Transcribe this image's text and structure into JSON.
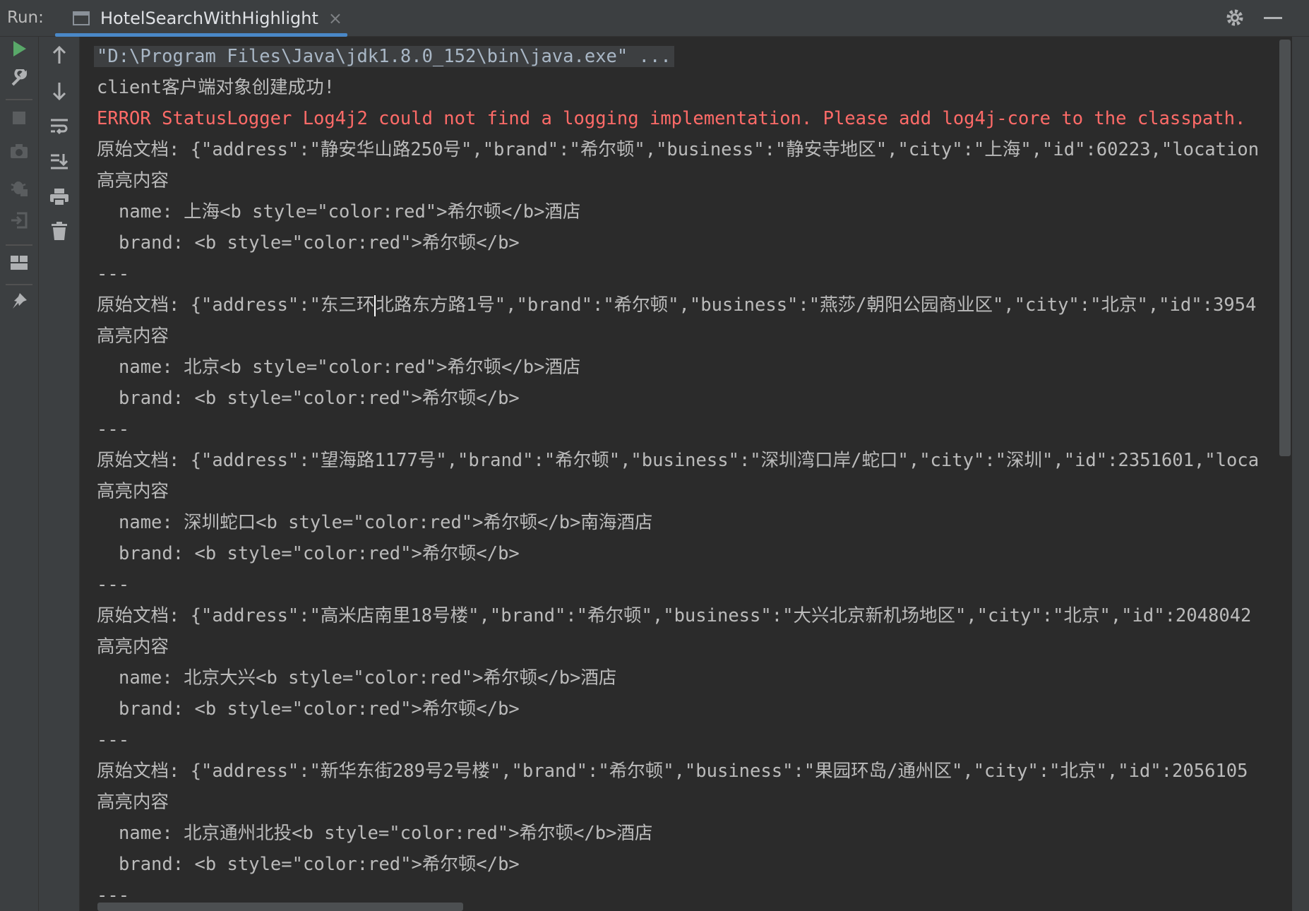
{
  "run_panel": {
    "label": "Run:",
    "tab_title": "HotelSearchWithHighlight",
    "tab_close": "×"
  },
  "colors": {
    "run_green": "#59a869",
    "error_red": "#ff6b68",
    "tab_underline": "#4a88c7",
    "console_bg": "#2b2b2b"
  },
  "toolbar_left": [
    "run-icon",
    "wrench-icon",
    "stop-icon",
    "camera-icon",
    "debug-bug-icon",
    "login-icon",
    "layout-icon",
    "pin-icon"
  ],
  "toolbar_right": [
    "up-arrow-icon",
    "down-arrow-icon",
    "soft-wrap-icon",
    "scroll-to-end-icon",
    "print-icon",
    "trash-icon"
  ],
  "console": {
    "cmd": "\"D:\\Program Files\\Java\\jdk1.8.0_152\\bin\\java.exe\" ...",
    "client_ok": "client客户端对象创建成功!",
    "error": "ERROR StatusLogger Log4j2 could not find a logging implementation. Please add log4j-core to the classpath.",
    "sep": "---",
    "highlight_label": "高亮内容",
    "records": [
      {
        "original": "原始文档: {\"address\":\"静安华山路250号\",\"brand\":\"希尔顿\",\"business\":\"静安寺地区\",\"city\":\"上海\",\"id\":60223,\"location",
        "name": "name: 上海<b style=\"color:red\">希尔顿</b>酒店",
        "brand": "brand: <b style=\"color:red\">希尔顿</b>"
      },
      {
        "original_a": "原始文档: {\"address\":\"东三环",
        "original_b": "北路东方路1号\",\"brand\":\"希尔顿\",\"business\":\"燕莎/朝阳公园商业区\",\"city\":\"北京\",\"id\":3954",
        "name": "name: 北京<b style=\"color:red\">希尔顿</b>酒店",
        "brand": "brand: <b style=\"color:red\">希尔顿</b>"
      },
      {
        "original": "原始文档: {\"address\":\"望海路1177号\",\"brand\":\"希尔顿\",\"business\":\"深圳湾口岸/蛇口\",\"city\":\"深圳\",\"id\":2351601,\"loca",
        "name": "name: 深圳蛇口<b style=\"color:red\">希尔顿</b>南海酒店",
        "brand": "brand: <b style=\"color:red\">希尔顿</b>"
      },
      {
        "original": "原始文档: {\"address\":\"高米店南里18号楼\",\"brand\":\"希尔顿\",\"business\":\"大兴北京新机场地区\",\"city\":\"北京\",\"id\":2048042",
        "name": "name: 北京大兴<b style=\"color:red\">希尔顿</b>酒店",
        "brand": "brand: <b style=\"color:red\">希尔顿</b>"
      },
      {
        "original": "原始文档: {\"address\":\"新华东街289号2号楼\",\"brand\":\"希尔顿\",\"business\":\"果园环岛/通州区\",\"city\":\"北京\",\"id\":2056105",
        "name": "name: 北京通州北投<b style=\"color:red\">希尔顿</b>酒店",
        "brand": "brand: <b style=\"color:red\">希尔顿</b>"
      }
    ]
  }
}
